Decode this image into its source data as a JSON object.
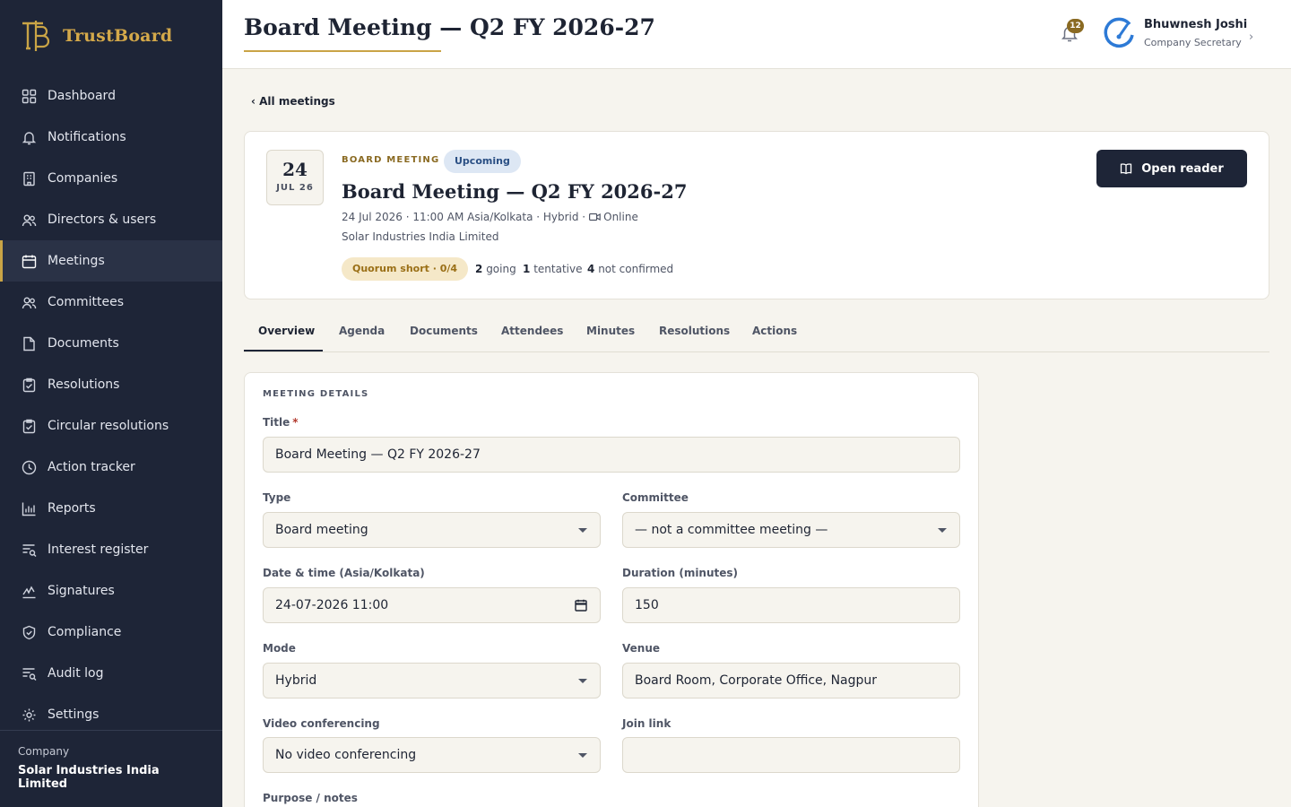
{
  "brand": {
    "name": "TrustBoard"
  },
  "sidebar": {
    "items": [
      {
        "label": "Dashboard",
        "icon": "grid-icon"
      },
      {
        "label": "Notifications",
        "icon": "bell-icon"
      },
      {
        "label": "Companies",
        "icon": "building-icon"
      },
      {
        "label": "Directors & users",
        "icon": "users-icon"
      },
      {
        "label": "Meetings",
        "icon": "calendar-icon",
        "active": true
      },
      {
        "label": "Committees",
        "icon": "users-icon"
      },
      {
        "label": "Documents",
        "icon": "file-icon"
      },
      {
        "label": "Resolutions",
        "icon": "clipboard-check-icon"
      },
      {
        "label": "Circular resolutions",
        "icon": "clipboard-check-icon"
      },
      {
        "label": "Action tracker",
        "icon": "clock-icon"
      },
      {
        "label": "Reports",
        "icon": "bar-chart-icon"
      },
      {
        "label": "Interest register",
        "icon": "list-search-icon"
      },
      {
        "label": "Signatures",
        "icon": "signature-icon"
      },
      {
        "label": "Compliance",
        "icon": "shield-check-icon"
      },
      {
        "label": "Audit log",
        "icon": "list-search-icon"
      },
      {
        "label": "Settings",
        "icon": "gear-icon"
      }
    ],
    "footer": {
      "label": "Company",
      "company": "Solar Industries India Limited"
    }
  },
  "header": {
    "title": "Board Meeting — Q2 FY 2026-27",
    "notification_count": "12",
    "user": {
      "name": "Bhuwnesh Joshi",
      "role": "Company Secretary"
    },
    "chevron": "›"
  },
  "back_link": "‹ All meetings",
  "meeting": {
    "day": "24",
    "month": "JUL 26",
    "kicker": "BOARD MEETING",
    "status": "Upcoming",
    "title": "Board Meeting — Q2 FY 2026-27",
    "meta_prefix": "24 Jul 2026 · 11:00 AM Asia/Kolkata · Hybrid ·",
    "meta_online": "Online",
    "company": "Solar Industries India Limited",
    "quorum": "Quorum short · 0/4",
    "rsvp": {
      "going_count": "2",
      "going_label": "going",
      "tentative_count": "1",
      "tentative_label": "tentative",
      "not_confirmed_count": "4",
      "not_confirmed_label": "not confirmed"
    },
    "open_reader": "Open reader"
  },
  "tabs": [
    "Overview",
    "Agenda",
    "Documents",
    "Attendees",
    "Minutes",
    "Resolutions",
    "Actions"
  ],
  "active_tab": "Overview",
  "form": {
    "section": "MEETING DETAILS",
    "title_label": "Title",
    "required_mark": "*",
    "title_value": "Board Meeting — Q2 FY 2026-27",
    "type_label": "Type",
    "type_value": "Board meeting",
    "committee_label": "Committee",
    "committee_value": "— not a committee meeting —",
    "datetime_label": "Date & time (Asia/Kolkata)",
    "datetime_value": "24-07-2026 11:00",
    "duration_label": "Duration (minutes)",
    "duration_value": "150",
    "mode_label": "Mode",
    "mode_value": "Hybrid",
    "venue_label": "Venue",
    "venue_value": "Board Room, Corporate Office, Nagpur",
    "video_label": "Video conferencing",
    "video_value": "No video conferencing",
    "join_label": "Join link",
    "join_value": "",
    "purpose_label": "Purpose / notes"
  },
  "colors": {
    "sidebar_bg": "#1e2537",
    "accent_gold": "#c9a446",
    "page_bg": "#f6f4ee",
    "status_blue": "#dde7f4",
    "quorum_amber": "#f5e8c8"
  }
}
